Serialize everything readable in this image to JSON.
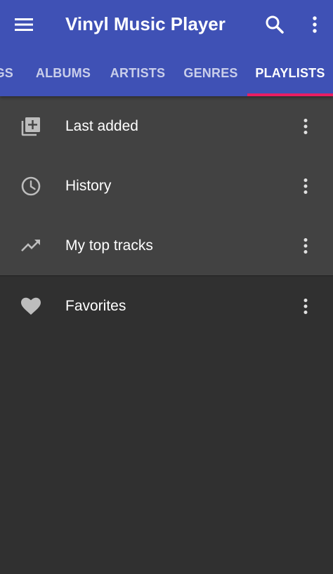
{
  "app_title": "Vinyl Music Player",
  "toolbar": {
    "menu_icon": "menu-icon",
    "search_icon": "search-icon",
    "overflow_icon": "more-vertical-icon"
  },
  "tabs": [
    {
      "label": "SONGS",
      "visible_fragment": "GS",
      "active": false
    },
    {
      "label": "ALBUMS",
      "active": false
    },
    {
      "label": "ARTISTS",
      "active": false
    },
    {
      "label": "GENRES",
      "active": false
    },
    {
      "label": "PLAYLISTS",
      "active": true
    }
  ],
  "playlists": {
    "smart": [
      {
        "label": "Last added",
        "icon": "playlist-add-icon"
      },
      {
        "label": "History",
        "icon": "clock-icon"
      },
      {
        "label": "My top tracks",
        "icon": "trending-up-icon"
      }
    ],
    "user": [
      {
        "label": "Favorites",
        "icon": "heart-icon"
      }
    ]
  },
  "colors": {
    "primary": "#3f51b5",
    "accent": "#e91e63",
    "background": "#303030",
    "smart_section_background": "#424242",
    "text": "#ffffff",
    "icon": "#bdbdbd"
  }
}
